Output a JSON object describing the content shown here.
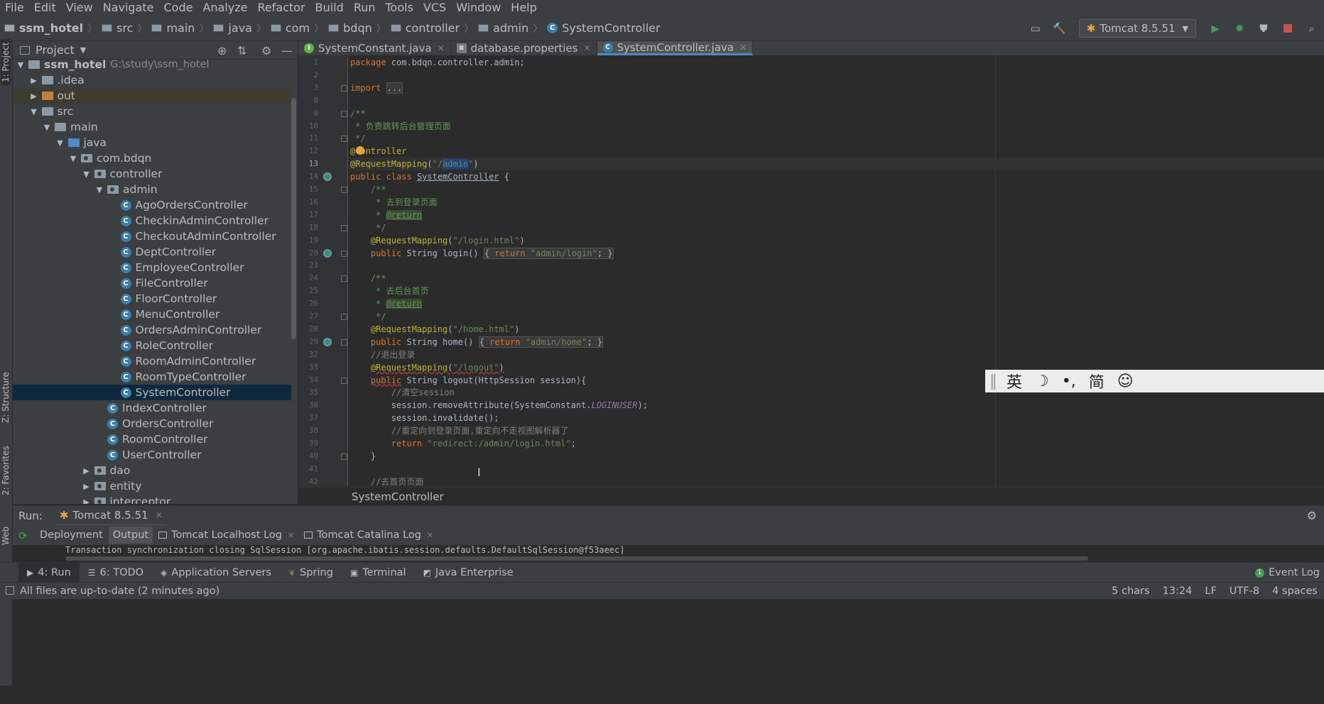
{
  "menu": [
    "File",
    "Edit",
    "View",
    "Navigate",
    "Code",
    "Analyze",
    "Refactor",
    "Build",
    "Run",
    "Tools",
    "VCS",
    "Window",
    "Help"
  ],
  "breadcrumb": {
    "project": "ssm_hotel",
    "parts": [
      "src",
      "main",
      "java",
      "com",
      "bdqn",
      "controller",
      "admin"
    ],
    "file": "SystemController"
  },
  "run_config": "Tomcat 8.5.51",
  "project_panel": {
    "title": "Project",
    "strip_project": "1: Project",
    "strip_structure": "Z: Structure",
    "strip_favorites": "2: Favorites",
    "strip_web": "Web"
  },
  "tree": [
    {
      "label": "ssm_hotel",
      "path": "G:\\study\\ssm_hotel",
      "depth": 0,
      "type": "project",
      "open": true,
      "bold": true
    },
    {
      "label": ".idea",
      "depth": 1,
      "type": "folder",
      "open": false
    },
    {
      "label": "out",
      "depth": 1,
      "type": "out",
      "open": false
    },
    {
      "label": "src",
      "depth": 1,
      "type": "folder",
      "open": true
    },
    {
      "label": "main",
      "depth": 2,
      "type": "folder",
      "open": true
    },
    {
      "label": "java",
      "depth": 3,
      "type": "src",
      "open": true
    },
    {
      "label": "com.bdqn",
      "depth": 4,
      "type": "pkg",
      "open": true
    },
    {
      "label": "controller",
      "depth": 5,
      "type": "pkg",
      "open": true
    },
    {
      "label": "admin",
      "depth": 6,
      "type": "pkg",
      "open": true
    },
    {
      "label": "AgoOrdersController",
      "depth": 7,
      "type": "class"
    },
    {
      "label": "CheckinAdminController",
      "depth": 7,
      "type": "class"
    },
    {
      "label": "CheckoutAdminController",
      "depth": 7,
      "type": "class"
    },
    {
      "label": "DeptController",
      "depth": 7,
      "type": "class"
    },
    {
      "label": "EmployeeController",
      "depth": 7,
      "type": "class"
    },
    {
      "label": "FileController",
      "depth": 7,
      "type": "class"
    },
    {
      "label": "FloorController",
      "depth": 7,
      "type": "class"
    },
    {
      "label": "MenuController",
      "depth": 7,
      "type": "class"
    },
    {
      "label": "OrdersAdminController",
      "depth": 7,
      "type": "class"
    },
    {
      "label": "RoleController",
      "depth": 7,
      "type": "class"
    },
    {
      "label": "RoomAdminController",
      "depth": 7,
      "type": "class"
    },
    {
      "label": "RoomTypeController",
      "depth": 7,
      "type": "class"
    },
    {
      "label": "SystemController",
      "depth": 7,
      "type": "class",
      "selected": true
    },
    {
      "label": "IndexController",
      "depth": 6,
      "type": "class"
    },
    {
      "label": "OrdersController",
      "depth": 6,
      "type": "class"
    },
    {
      "label": "RoomController",
      "depth": 6,
      "type": "class"
    },
    {
      "label": "UserController",
      "depth": 6,
      "type": "class"
    },
    {
      "label": "dao",
      "depth": 5,
      "type": "pkg",
      "open": false
    },
    {
      "label": "entity",
      "depth": 5,
      "type": "pkg",
      "open": false
    },
    {
      "label": "interceptor",
      "depth": 5,
      "type": "pkg",
      "open": false
    }
  ],
  "tabs": [
    {
      "label": "SystemConstant.java",
      "icon": "interface-icon",
      "active": false
    },
    {
      "label": "database.properties",
      "icon": "properties-icon",
      "active": false
    },
    {
      "label": "SystemController.java",
      "icon": "class-icon",
      "active": true
    }
  ],
  "code": [
    {
      "n": "1",
      "html": "<span class='k'>package</span> com.bdqn.controller.admin;"
    },
    {
      "n": "2",
      "html": ""
    },
    {
      "n": "3",
      "html": "<span class='k'>import</span> <span class='fold'>...</span>"
    },
    {
      "n": "8",
      "html": ""
    },
    {
      "n": "9",
      "html": "<span class='d'>/**</span>"
    },
    {
      "n": "10",
      "html": "<span class='d'> * 负责跳转后台管理页面</span>"
    },
    {
      "n": "11",
      "html": "<span class='d'> */</span>"
    },
    {
      "n": "12",
      "html": "<span class='a'>@Controller</span>"
    },
    {
      "n": "13",
      "html": "<span class='a'>@RequestMapping</span>(<span class='s'>\"/<span class='sel'>admin</span>\"</span>)",
      "current": true
    },
    {
      "n": "14",
      "html": "<span class='k'>public class</span> <span style='text-decoration:underline'>SystemController</span> {"
    },
    {
      "n": "15",
      "html": "    <span class='d'>/**</span>"
    },
    {
      "n": "16",
      "html": "<span class='d'>     * 去到登录页面</span>"
    },
    {
      "n": "17",
      "html": "<span class='d'>     * </span><span class='dt'>@return</span>"
    },
    {
      "n": "18",
      "html": "<span class='d'>     */</span>"
    },
    {
      "n": "19",
      "html": "    <span class='a'>@RequestMapping</span>(<span class='s'>\"/login.html\"</span>)"
    },
    {
      "n": "20",
      "html": "    <span class='k'>public</span> String login() <span class='fold'>{ <span class='k'>return</span> <span class='s'>\"admin/login\"</span>; }</span>"
    },
    {
      "n": "23",
      "html": ""
    },
    {
      "n": "24",
      "html": "    <span class='d'>/**</span>"
    },
    {
      "n": "25",
      "html": "<span class='d'>     * 去后台首页</span>"
    },
    {
      "n": "26",
      "html": "<span class='d'>     * </span><span class='dt'>@return</span>"
    },
    {
      "n": "27",
      "html": "<span class='d'>     */</span>"
    },
    {
      "n": "28",
      "html": "    <span class='a'>@RequestMapping</span>(<span class='s'>\"/home.html\"</span>)"
    },
    {
      "n": "29",
      "html": "    <span class='k'>public</span> String home() <span class='fold'>{ <span class='k'>return</span> <span class='s'>\"admin/home\"</span>; }</span>"
    },
    {
      "n": "32",
      "html": "    <span class='c'>//退出登录</span>"
    },
    {
      "n": "33",
      "html": "    <span class='a u'>@RequestMapping</span><span class='u'>(</span><span class='s u'>\"/logout\"</span><span class='u'>)</span>"
    },
    {
      "n": "34",
      "html": "    <span class='k u'>public</span> String logout(HttpSession session){"
    },
    {
      "n": "35",
      "html": "        <span class='c'>//清空session</span>"
    },
    {
      "n": "36",
      "html": "        session.removeAttribute(SystemConstant.<i style='color:#9876aa'>LOGINUSER</i>);"
    },
    {
      "n": "37",
      "html": "        session.invalidate();"
    },
    {
      "n": "38",
      "html": "        <span class='c'>//重定向到登录页面,重定向不走视图解析器了</span>"
    },
    {
      "n": "39",
      "html": "        <span class='k'>return</span> <span class='s'>\"redirect:/admin/login.html\"</span>;"
    },
    {
      "n": "40",
      "html": "    }"
    },
    {
      "n": "41",
      "html": ""
    },
    {
      "n": "42",
      "html": "    <span class='c'>//去首页页面</span>"
    }
  ],
  "editor_breadcrumb": "SystemController",
  "ime": [
    "英",
    "☽",
    "•,",
    "简",
    "☺"
  ],
  "run_panel": {
    "label": "Run:",
    "config": "Tomcat 8.5.51",
    "tabs": [
      "Deployment",
      "Output",
      "Tomcat Localhost Log",
      "Tomcat Catalina Log"
    ],
    "active_tab": "Output",
    "output_line": "Transaction synchronization closing SqlSession [org.apache.ibatis.session.defaults.DefaultSqlSession@f53aeec]"
  },
  "toolwindows": [
    "4: Run",
    "6: TODO",
    "Application Servers",
    "Spring",
    "Terminal",
    "Java Enterprise"
  ],
  "event_log": "Event Log",
  "status": {
    "message": "All files are up-to-date (2 minutes ago)",
    "chars": "5 chars",
    "position": "13:24",
    "line_sep": "LF",
    "encoding": "UTF-8",
    "indent": "4 spaces"
  }
}
